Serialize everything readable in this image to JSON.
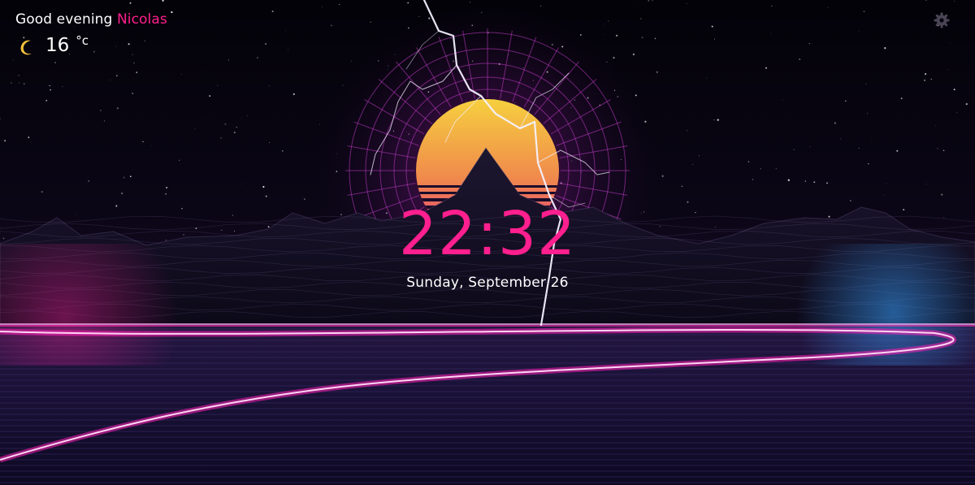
{
  "greeting": {
    "prefix": "Good evening",
    "name": "Nicolas"
  },
  "weather": {
    "icon": "moon-icon",
    "temperature": "16",
    "unit": "°c"
  },
  "settings": {
    "icon": "gear-icon"
  },
  "clock": {
    "time": "22:32",
    "date": "Sunday, September 26"
  },
  "colors": {
    "accent": "#ff1f8e",
    "text": "#ffffff",
    "sun_top": "#f4d03f",
    "sun_bottom": "#e0357a",
    "sky": "#07040f"
  }
}
